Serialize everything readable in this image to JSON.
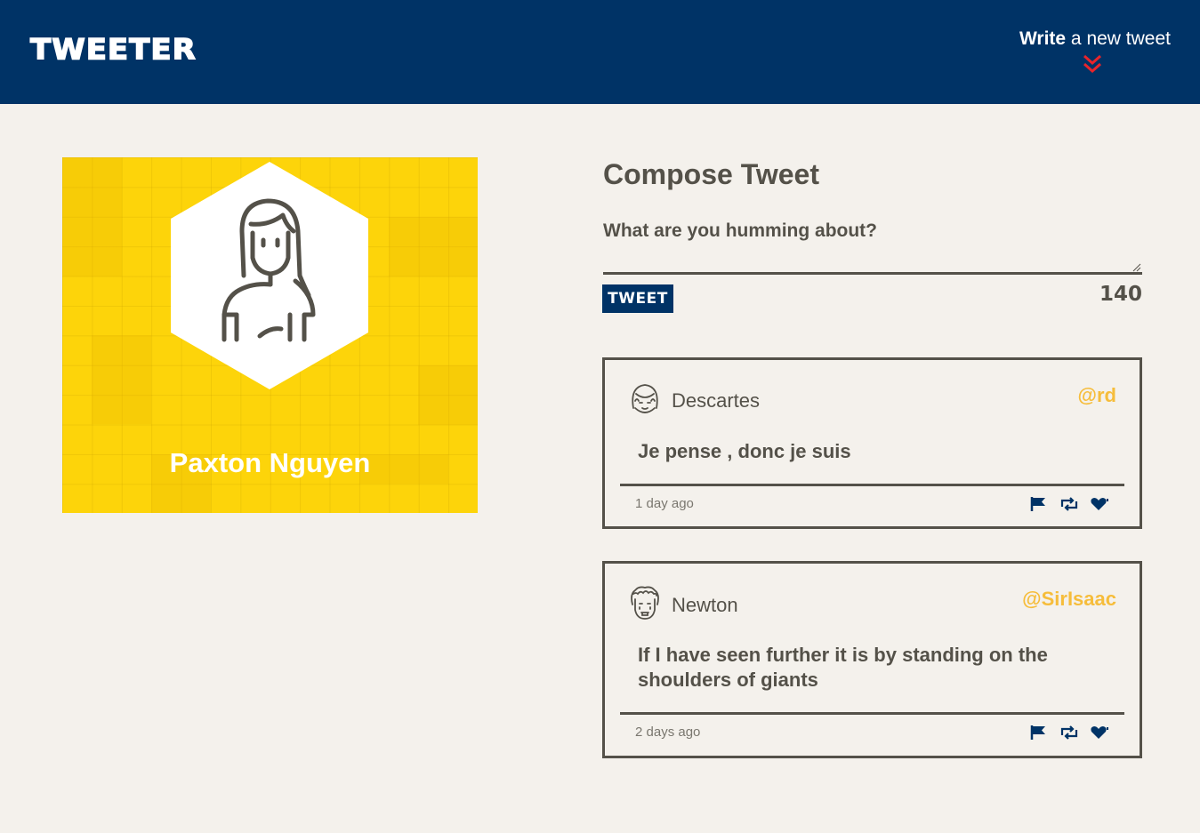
{
  "nav": {
    "logo": "TWEETER",
    "write_bold": "Write",
    "write_rest": " a new tweet",
    "icons": [
      "double-chevron-down-icon"
    ]
  },
  "profile": {
    "name": "Paxton Nguyen",
    "background_color": "#fdd40a"
  },
  "compose": {
    "title": "Compose Tweet",
    "placeholder": "What are you humming about?",
    "button_label": "TWEET",
    "counter": "140"
  },
  "tweets": [
    {
      "name": "Descartes",
      "handle": "@rd",
      "text": "Je pense , donc je suis",
      "time": "1 day ago",
      "icons": [
        "flag-icon",
        "retweet-icon",
        "heart-icon"
      ]
    },
    {
      "name": "Newton",
      "handle": "@SirIsaac",
      "text": "If I have seen further it is by standing on the shoulders of giants",
      "time": "2 days ago",
      "icons": [
        "flag-icon",
        "retweet-icon",
        "heart-icon"
      ]
    }
  ],
  "colors": {
    "nav": "#003366",
    "accent": "#f6bd3b",
    "chevron": "#e8242b",
    "text": "#545149",
    "background": "#f4f1ec"
  }
}
